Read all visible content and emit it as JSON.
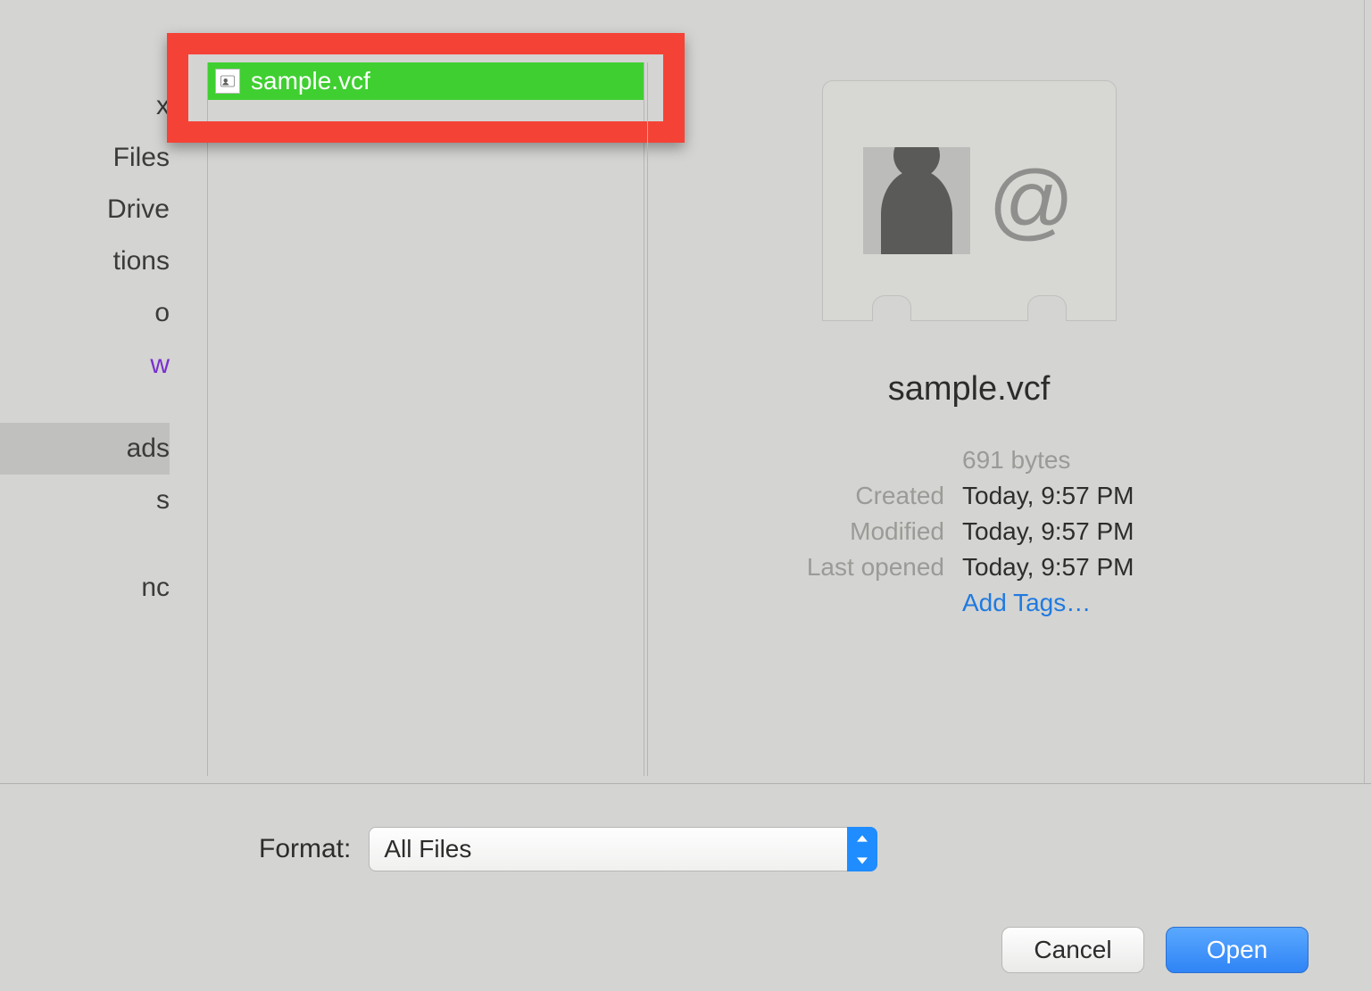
{
  "sidebar": {
    "items": [
      {
        "label": "x"
      },
      {
        "label": "Files"
      },
      {
        "label": "Drive"
      },
      {
        "label": "tions"
      },
      {
        "label": "o"
      },
      {
        "label": "w",
        "purple": true
      },
      {
        "label": "ads",
        "selected": true
      },
      {
        "label": "s"
      },
      {
        "label": "nc"
      }
    ]
  },
  "file_list": {
    "selected_file": "sample.vcf",
    "icon_semantic": "vcf-file-icon"
  },
  "preview": {
    "filename": "sample.vcf",
    "size": "691 bytes",
    "created_label": "Created",
    "created_value": "Today, 9:57 PM",
    "modified_label": "Modified",
    "modified_value": "Today, 9:57 PM",
    "lastopened_label": "Last opened",
    "lastopened_value": "Today, 9:57 PM",
    "add_tags": "Add Tags…",
    "icons": {
      "avatar": "person-silhouette-icon",
      "at": "at-sign-icon"
    }
  },
  "format": {
    "label": "Format:",
    "value": "All Files"
  },
  "buttons": {
    "cancel": "Cancel",
    "open": "Open"
  }
}
